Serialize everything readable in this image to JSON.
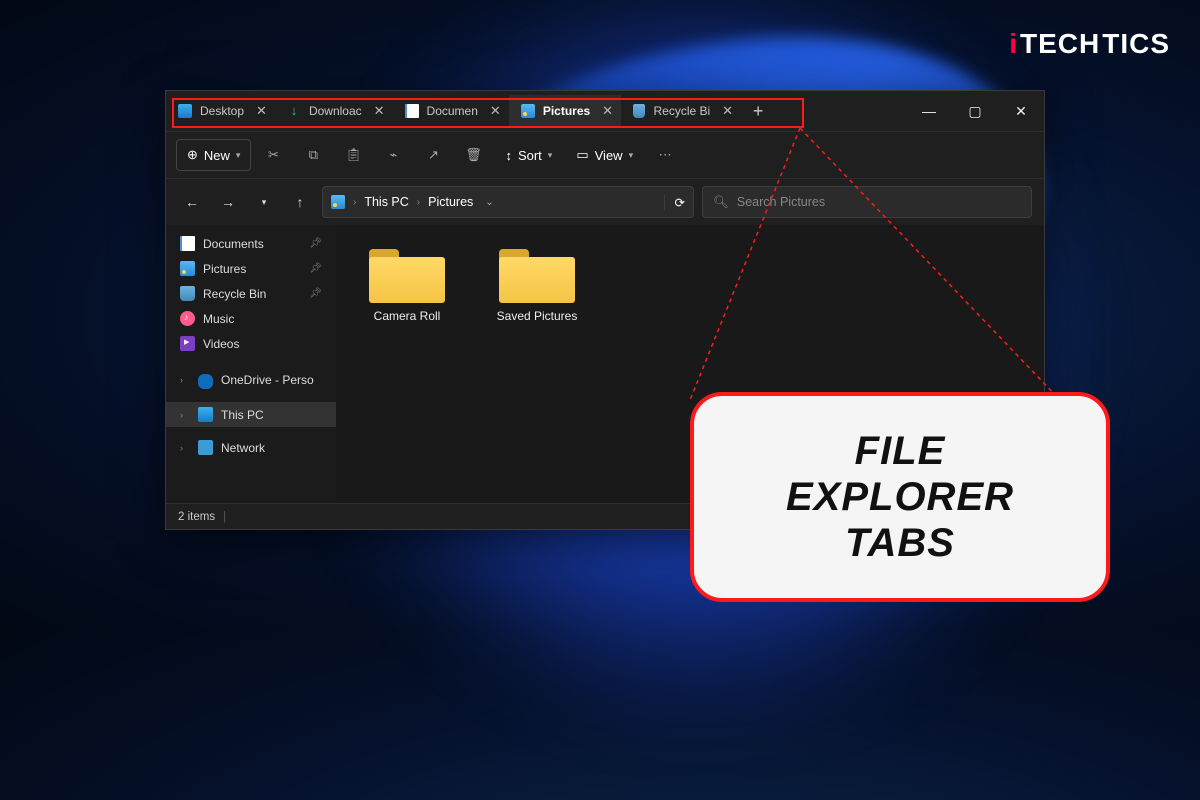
{
  "brand": {
    "prefix": "i",
    "bold": "TECH",
    "suffix": "TICS"
  },
  "tabs": [
    {
      "label": "Desktop",
      "icon": "desktop",
      "active": false
    },
    {
      "label": "Downloac",
      "icon": "download",
      "active": false
    },
    {
      "label": "Documen",
      "icon": "document",
      "active": false
    },
    {
      "label": "Pictures",
      "icon": "pictures",
      "active": true
    },
    {
      "label": "Recycle Bi",
      "icon": "recycle",
      "active": false
    }
  ],
  "toolbar": {
    "new_label": "New",
    "sort_label": "Sort",
    "view_label": "View"
  },
  "breadcrumb": {
    "root": "This PC",
    "current": "Pictures"
  },
  "search_placeholder": "Search Pictures",
  "sidebar": {
    "quick": [
      {
        "label": "Documents",
        "icon": "document",
        "pinned": true
      },
      {
        "label": "Pictures",
        "icon": "pictures",
        "pinned": true
      },
      {
        "label": "Recycle Bin",
        "icon": "recycle",
        "pinned": true
      },
      {
        "label": "Music",
        "icon": "music",
        "pinned": false
      },
      {
        "label": "Videos",
        "icon": "videos",
        "pinned": false
      }
    ],
    "roots": [
      {
        "label": "OneDrive - Perso",
        "icon": "onedrive",
        "expandable": true,
        "active": false
      },
      {
        "label": "This PC",
        "icon": "thispc",
        "expandable": true,
        "active": true
      },
      {
        "label": "Network",
        "icon": "network",
        "expandable": true,
        "active": false
      }
    ]
  },
  "folders": [
    {
      "label": "Camera Roll"
    },
    {
      "label": "Saved Pictures"
    }
  ],
  "status": {
    "count_label": "2 items"
  },
  "callout": {
    "line1": "FILE",
    "line2": "EXPLORER",
    "line3": "TABS"
  }
}
